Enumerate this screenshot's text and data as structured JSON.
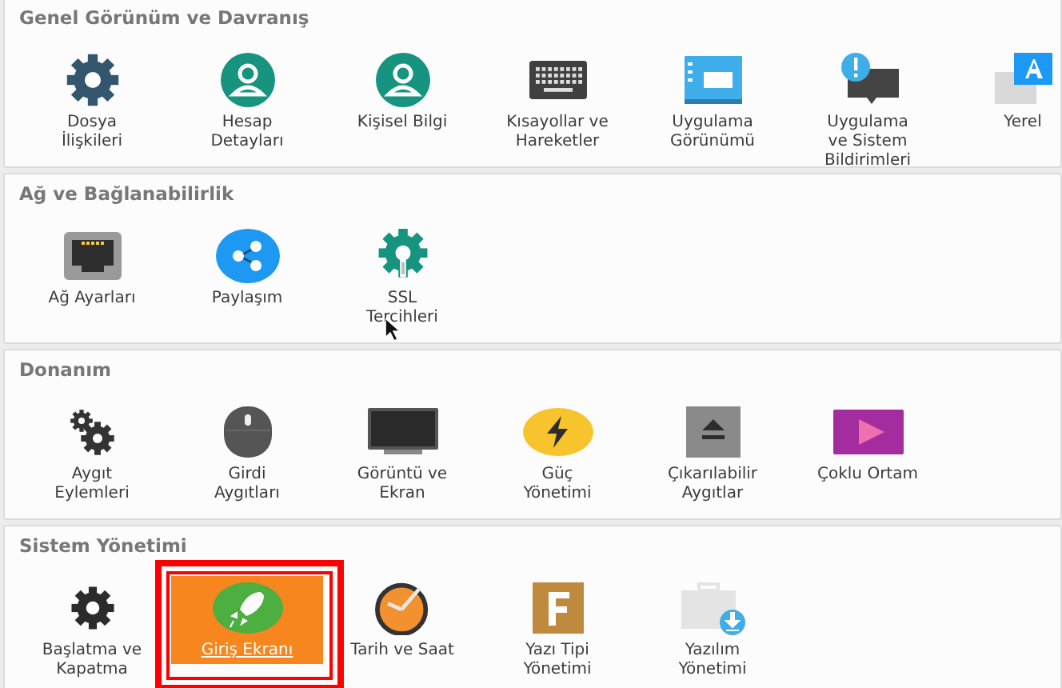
{
  "sections": [
    {
      "title": "Genel Görünüm ve Davranış",
      "items": [
        {
          "label": "Dosya İlişkileri",
          "kind": "gear",
          "selected": false
        },
        {
          "label": "Hesap Detayları",
          "kind": "person",
          "selected": false
        },
        {
          "label": "Kişisel Bilgi",
          "kind": "person",
          "selected": false
        },
        {
          "label": "Kısayollar ve Hareketler",
          "kind": "keyboard",
          "selected": false
        },
        {
          "label": "Uygulama Görünümü",
          "kind": "window",
          "selected": false
        },
        {
          "label": "Uygulama ve Sistem Bildirimleri",
          "kind": "notification",
          "selected": false
        },
        {
          "label": "Yerel",
          "kind": "language",
          "selected": false
        }
      ]
    },
    {
      "title": "Ağ ve Bağlanabilirlik",
      "items": [
        {
          "label": "Ağ Ayarları",
          "kind": "ethernet",
          "selected": false
        },
        {
          "label": "Paylaşım",
          "kind": "share",
          "selected": false
        },
        {
          "label": "SSL Tercihleri",
          "kind": "ssl",
          "selected": false
        }
      ]
    },
    {
      "title": "Donanım",
      "items": [
        {
          "label": "Aygıt Eylemleri",
          "kind": "gears",
          "selected": false
        },
        {
          "label": "Girdi Aygıtları",
          "kind": "mouse",
          "selected": false
        },
        {
          "label": "Görüntü ve Ekran",
          "kind": "monitor",
          "selected": false
        },
        {
          "label": "Güç Yönetimi",
          "kind": "power",
          "selected": false
        },
        {
          "label": "Çıkarılabilir Aygıtlar",
          "kind": "eject",
          "selected": false
        },
        {
          "label": "Çoklu Ortam",
          "kind": "media",
          "selected": false
        }
      ]
    },
    {
      "title": "Sistem Yönetimi",
      "items": [
        {
          "label": "Başlatma ve Kapatma",
          "kind": "darkgear",
          "selected": false
        },
        {
          "label": "Giriş Ekranı",
          "kind": "rocket",
          "selected": true
        },
        {
          "label": "Tarih ve Saat",
          "kind": "clock",
          "selected": false
        },
        {
          "label": "Yazı Tipi Yönetimi",
          "kind": "font",
          "selected": false
        },
        {
          "label": "Yazılım Yönetimi",
          "kind": "software",
          "selected": false
        }
      ]
    }
  ]
}
